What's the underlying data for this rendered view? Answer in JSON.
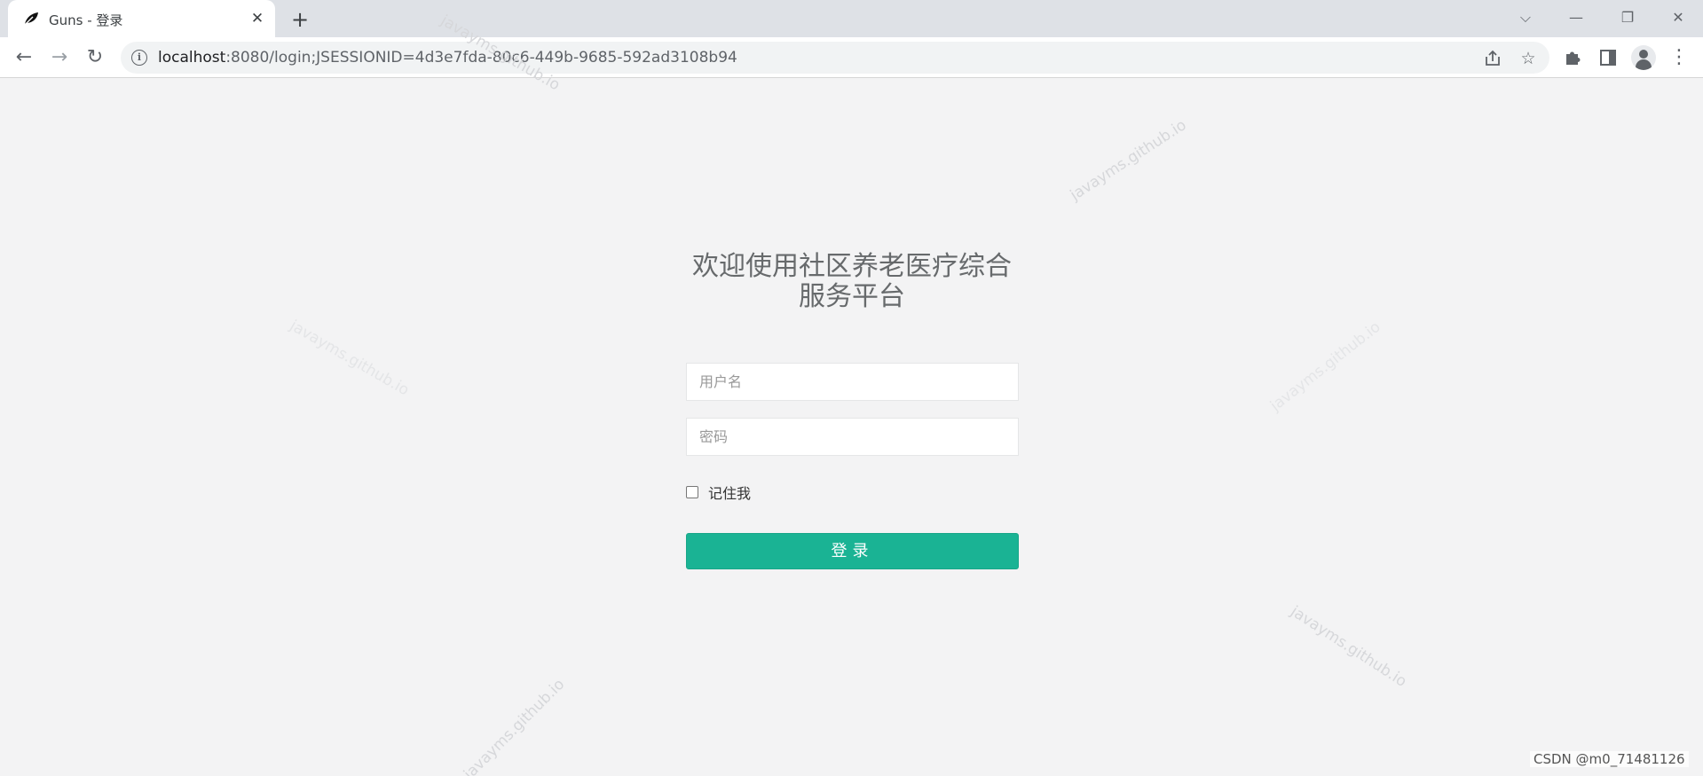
{
  "browser": {
    "tab": {
      "title": "Guns - 登录",
      "close_label": "✕"
    },
    "new_tab_label": "+",
    "address": {
      "host": "localhost",
      "rest": ":8080/login;JSESSIONID=4d3e7fda-80c6-449b-9685-592ad3108b94"
    },
    "window_controls": {
      "dropdown": "⌵",
      "minimize": "—",
      "restore": "❐",
      "close": "✕"
    },
    "nav": {
      "back": "←",
      "forward": "→",
      "reload": "↻"
    }
  },
  "login": {
    "title_line1": "欢迎使用社区养老医疗综合",
    "title_line2": "服务平台",
    "username_placeholder": "用户名",
    "password_placeholder": "密码",
    "remember_label": "记住我",
    "submit_label": "登录"
  },
  "watermark_text": "javayms.github.io",
  "footer_credit": "CSDN @m0_71481126",
  "colors": {
    "primary": "#1ab394",
    "background": "#f3f3f4",
    "title": "#676a6c"
  }
}
